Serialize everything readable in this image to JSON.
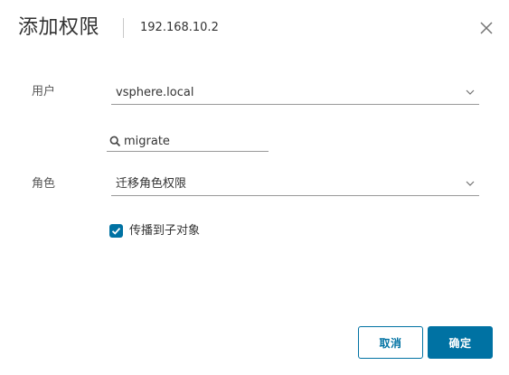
{
  "dialog": {
    "title": "添加权限",
    "subtitle": "192.168.10.2",
    "close_icon": "close-icon"
  },
  "user": {
    "label": "用户",
    "domain_value": "vsphere.local",
    "search_icon": "search-icon",
    "search_value": "migrate",
    "search_placeholder": ""
  },
  "role": {
    "label": "角色",
    "value": "迁移角色权限"
  },
  "propagate": {
    "label": "传播到子对象",
    "checked": true
  },
  "buttons": {
    "cancel_label": "取消",
    "ok_label": "确定"
  },
  "colors": {
    "primary": "#0072a3",
    "text": "#333333",
    "underline": "#999999"
  }
}
